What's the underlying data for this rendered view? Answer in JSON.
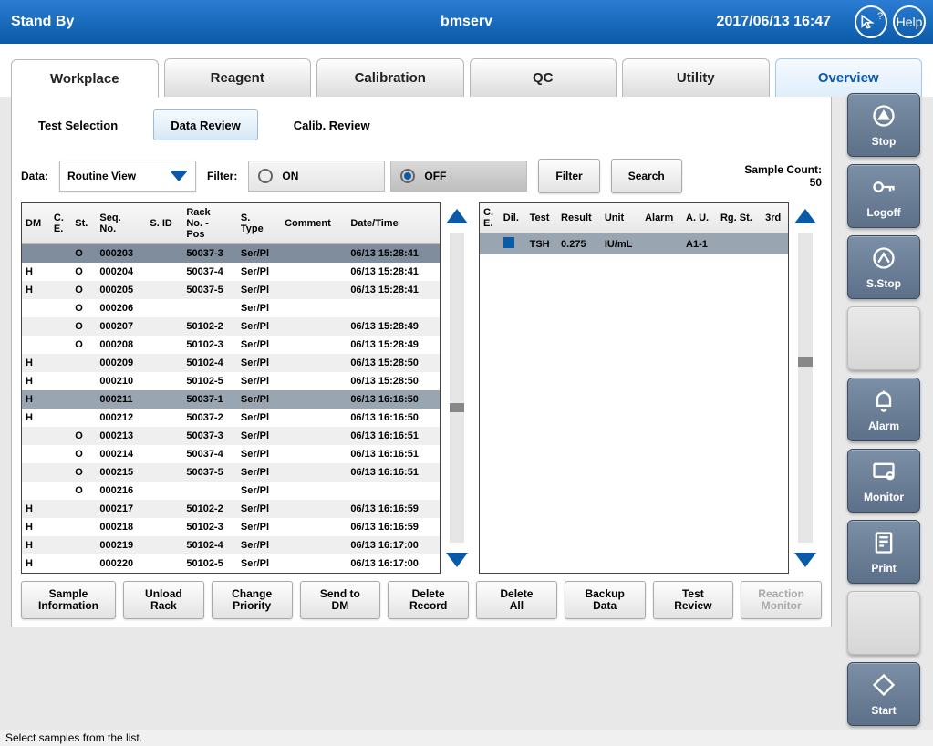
{
  "header": {
    "status": "Stand By",
    "user": "bmserv",
    "datetime": "2017/06/13   16:47",
    "help_label": "Help",
    "pointer_label": "?"
  },
  "main_tabs": [
    {
      "label": "Workplace",
      "state": "active"
    },
    {
      "label": "Reagent"
    },
    {
      "label": "Calibration"
    },
    {
      "label": "QC"
    },
    {
      "label": "Utility"
    },
    {
      "label": "Overview",
      "state": "overview"
    }
  ],
  "sub_tabs": [
    {
      "label": "Test Selection"
    },
    {
      "label": "Data Review",
      "state": "selected"
    },
    {
      "label": "Calib. Review"
    }
  ],
  "filter": {
    "data_label": "Data:",
    "data_value": "Routine View",
    "filter_label": "Filter:",
    "on_label": "ON",
    "off_label": "OFF",
    "selected": "OFF",
    "filter_btn": "Filter",
    "search_btn": "Search",
    "sample_count_label": "Sample Count:",
    "sample_count_value": "50"
  },
  "left_columns": [
    "DM",
    "C.\nE.",
    "St.",
    "Seq.\nNo.",
    "S. ID",
    "Rack\nNo. -\nPos",
    "S.\nType",
    "Comment",
    "Date/Time"
  ],
  "left_rows": [
    {
      "dm": "",
      "ce": "",
      "st": "O",
      "seq": "000203",
      "sid": "",
      "rack": "50037-3",
      "stype": "Ser/Pl",
      "comment": "",
      "dt": "06/13 15:28:41",
      "cls": "sel-b"
    },
    {
      "dm": "H",
      "ce": "",
      "st": "O",
      "seq": "000204",
      "sid": "",
      "rack": "50037-4",
      "stype": "Ser/Pl",
      "comment": "",
      "dt": "06/13 15:28:41",
      "cls": "striped-odd"
    },
    {
      "dm": "H",
      "ce": "",
      "st": "O",
      "seq": "000205",
      "sid": "",
      "rack": "50037-5",
      "stype": "Ser/Pl",
      "comment": "",
      "dt": "06/13 15:28:41",
      "cls": "striped-even"
    },
    {
      "dm": "",
      "ce": "",
      "st": "O",
      "seq": "000206",
      "sid": "",
      "rack": "",
      "stype": "Ser/Pl",
      "comment": "",
      "dt": "",
      "cls": "striped-odd"
    },
    {
      "dm": "",
      "ce": "",
      "st": "O",
      "seq": "000207",
      "sid": "",
      "rack": "50102-2",
      "stype": "Ser/Pl",
      "comment": "",
      "dt": "06/13 15:28:49",
      "cls": "striped-even"
    },
    {
      "dm": "",
      "ce": "",
      "st": "O",
      "seq": "000208",
      "sid": "",
      "rack": "50102-3",
      "stype": "Ser/Pl",
      "comment": "",
      "dt": "06/13 15:28:49",
      "cls": "striped-odd"
    },
    {
      "dm": "H",
      "ce": "",
      "st": "",
      "seq": "000209",
      "sid": "",
      "rack": "50102-4",
      "stype": "Ser/Pl",
      "comment": "",
      "dt": "06/13 15:28:50",
      "cls": "striped-even"
    },
    {
      "dm": "H",
      "ce": "",
      "st": "",
      "seq": "000210",
      "sid": "",
      "rack": "50102-5",
      "stype": "Ser/Pl",
      "comment": "",
      "dt": "06/13 15:28:50",
      "cls": "striped-odd"
    },
    {
      "dm": "H",
      "ce": "",
      "st": "",
      "seq": "000211",
      "sid": "",
      "rack": "50037-1",
      "stype": "Ser/Pl",
      "comment": "",
      "dt": "06/13 16:16:50",
      "cls": "sel"
    },
    {
      "dm": "H",
      "ce": "",
      "st": "",
      "seq": "000212",
      "sid": "",
      "rack": "50037-2",
      "stype": "Ser/Pl",
      "comment": "",
      "dt": "06/13 16:16:50",
      "cls": "striped-odd"
    },
    {
      "dm": "",
      "ce": "",
      "st": "O",
      "seq": "000213",
      "sid": "",
      "rack": "50037-3",
      "stype": "Ser/Pl",
      "comment": "",
      "dt": "06/13 16:16:51",
      "cls": "striped-even"
    },
    {
      "dm": "",
      "ce": "",
      "st": "O",
      "seq": "000214",
      "sid": "",
      "rack": "50037-4",
      "stype": "Ser/Pl",
      "comment": "",
      "dt": "06/13 16:16:51",
      "cls": "striped-odd"
    },
    {
      "dm": "",
      "ce": "",
      "st": "O",
      "seq": "000215",
      "sid": "",
      "rack": "50037-5",
      "stype": "Ser/Pl",
      "comment": "",
      "dt": "06/13 16:16:51",
      "cls": "striped-even"
    },
    {
      "dm": "",
      "ce": "",
      "st": "O",
      "seq": "000216",
      "sid": "",
      "rack": "",
      "stype": "Ser/Pl",
      "comment": "",
      "dt": "",
      "cls": "striped-odd"
    },
    {
      "dm": "H",
      "ce": "",
      "st": "",
      "seq": "000217",
      "sid": "",
      "rack": "50102-2",
      "stype": "Ser/Pl",
      "comment": "",
      "dt": "06/13 16:16:59",
      "cls": "striped-even"
    },
    {
      "dm": "H",
      "ce": "",
      "st": "",
      "seq": "000218",
      "sid": "",
      "rack": "50102-3",
      "stype": "Ser/Pl",
      "comment": "",
      "dt": "06/13 16:16:59",
      "cls": "striped-odd"
    },
    {
      "dm": "H",
      "ce": "",
      "st": "",
      "seq": "000219",
      "sid": "",
      "rack": "50102-4",
      "stype": "Ser/Pl",
      "comment": "",
      "dt": "06/13 16:17:00",
      "cls": "striped-even"
    },
    {
      "dm": "H",
      "ce": "",
      "st": "",
      "seq": "000220",
      "sid": "",
      "rack": "50102-5",
      "stype": "Ser/Pl",
      "comment": "",
      "dt": "06/13 16:17:00",
      "cls": "striped-odd"
    }
  ],
  "right_columns": [
    "C.\nE.",
    "Dil.",
    "Test",
    "Result",
    "Unit",
    "Alarm",
    "A. U.",
    "Rg. St.",
    "3rd"
  ],
  "right_rows": [
    {
      "ce": "",
      "dil": "",
      "test": "TSH",
      "result": "0.275",
      "unit": "IU/mL",
      "alarm": "",
      "au": "A1-1",
      "rg": "",
      "third": "",
      "cls": "sel",
      "icon": true
    }
  ],
  "actions": [
    {
      "label": "Sample\nInformation",
      "name": "sample-information"
    },
    {
      "label": "Unload\nRack",
      "name": "unload-rack"
    },
    {
      "label": "Change\nPriority",
      "name": "change-priority"
    },
    {
      "label": "Send to DM",
      "name": "send-to-dm"
    },
    {
      "label": "Delete Record",
      "name": "delete-record"
    },
    {
      "label": "Delete All",
      "name": "delete-all"
    },
    {
      "label": "Backup Data",
      "name": "backup-data"
    },
    {
      "label": "Test Review",
      "name": "test-review"
    },
    {
      "label": "Reaction\nMonitor",
      "name": "reaction-monitor",
      "disabled": true
    }
  ],
  "sidebar": [
    {
      "label": "Stop",
      "icon": "stop"
    },
    {
      "label": "Logoff",
      "icon": "key"
    },
    {
      "label": "S.Stop",
      "icon": "sstop"
    },
    {
      "label": "",
      "icon": "blank"
    },
    {
      "label": "Alarm",
      "icon": "bell"
    },
    {
      "label": "Monitor",
      "icon": "monitor"
    },
    {
      "label": "Print",
      "icon": "print"
    },
    {
      "label": "",
      "icon": "blank"
    },
    {
      "label": "Start",
      "icon": "start"
    }
  ],
  "status_bar": "Select samples from the list."
}
